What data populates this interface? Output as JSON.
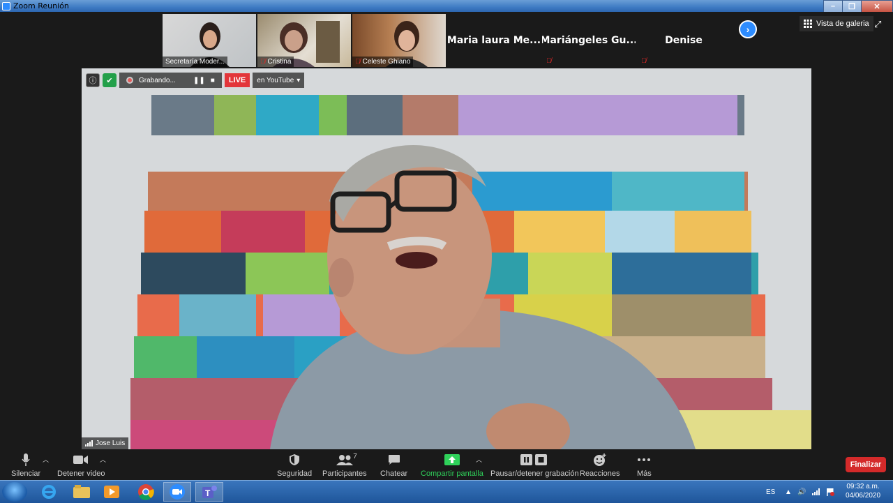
{
  "window": {
    "title": "Zoom Reunión"
  },
  "gallery_strip": {
    "video_tiles": [
      {
        "name": "Secretaría Moder...",
        "muted": false
      },
      {
        "name": "Cristina",
        "muted": true
      },
      {
        "name": "Celeste Ghiano",
        "muted": true
      }
    ],
    "name_tiles": [
      {
        "name": "Maria laura Me..."
      },
      {
        "name": "Mariángeles Gu..."
      },
      {
        "name": "Denise"
      }
    ],
    "next_icon": "chevron-right-icon",
    "view_toggle_label": "Vista de galeria"
  },
  "main_video": {
    "speaker_name": "Jose Luis",
    "recording": {
      "status": "Grabando...",
      "live_label": "LIVE",
      "stream_target": "en YouTube"
    }
  },
  "toolbar": {
    "mute": "Silenciar",
    "stop_video": "Detener video",
    "security": "Seguridad",
    "participants": "Participantes",
    "participants_count": "7",
    "chat": "Chatear",
    "share": "Compartir pantalla",
    "recording": "Pausar/detener grabación",
    "reactions": "Reacciones",
    "more": "Más",
    "end": "Finalizar"
  },
  "taskbar": {
    "language": "ES",
    "time": "09:32 a.m.",
    "date": "04/06/2020",
    "apps": [
      "windows-start-icon",
      "internet-explorer-icon",
      "file-explorer-icon",
      "media-player-icon",
      "chrome-icon",
      "zoom-icon",
      "teams-icon"
    ]
  },
  "colors": {
    "accent": "#2d8cff",
    "live": "#e3353a",
    "end": "#d42a2a",
    "share_green": "#2fd15a"
  }
}
